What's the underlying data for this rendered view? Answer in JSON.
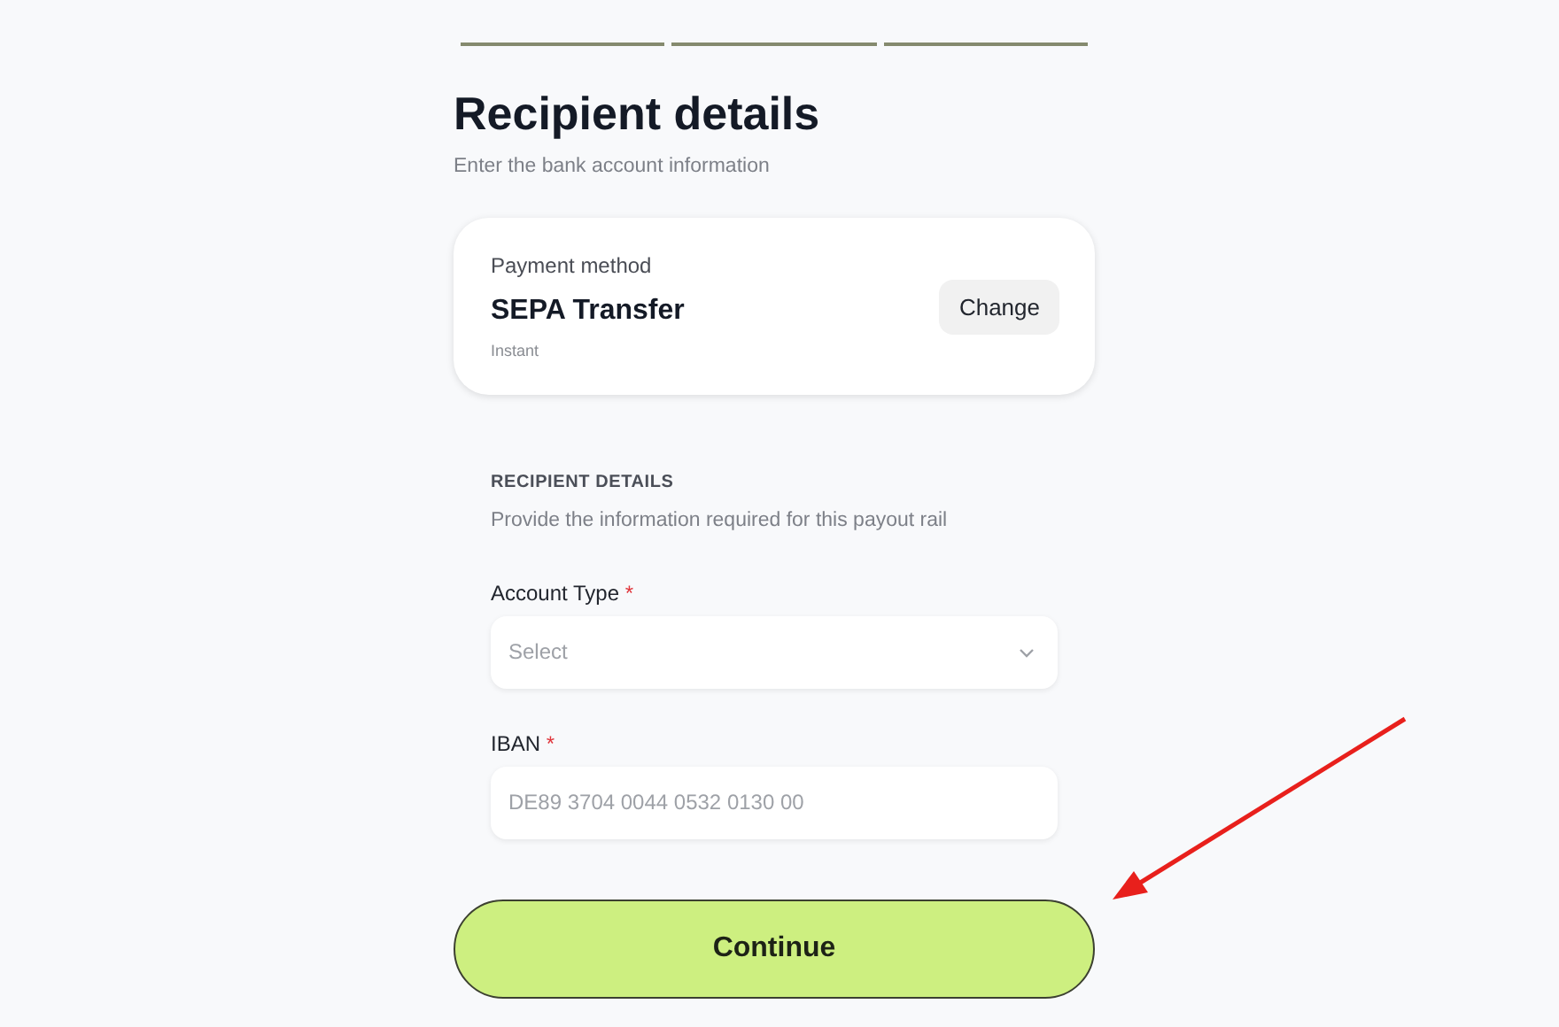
{
  "steps": [
    {
      "done": true
    },
    {
      "done": true
    },
    {
      "done": true
    }
  ],
  "header": {
    "title": "Recipient details",
    "subtitle": "Enter the bank account information"
  },
  "payment_method": {
    "label": "Payment method",
    "name": "SEPA Transfer",
    "speed": "Instant",
    "button": "Change"
  },
  "section": {
    "heading": "RECIPIENT DETAILS",
    "description": "Provide the information required for this payout rail"
  },
  "fields": [
    {
      "kind": "select",
      "label": "Account Type",
      "required_mark": "*",
      "placeholder": "Select"
    },
    {
      "kind": "text",
      "label": "IBAN",
      "required_mark": "*",
      "placeholder": "DE89 3704 0044 0532 0130 00"
    }
  ],
  "primary_button": "Continue"
}
